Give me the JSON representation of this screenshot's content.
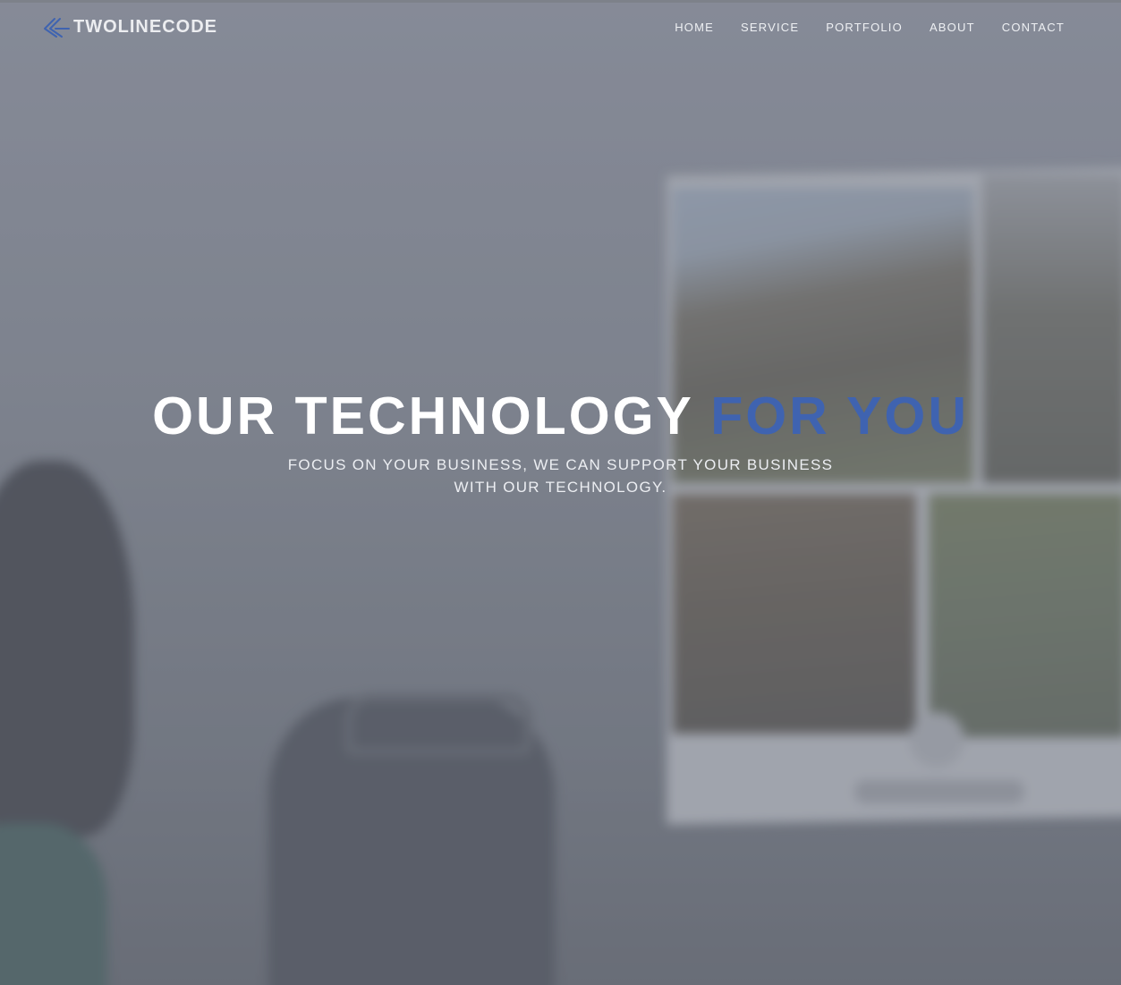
{
  "brand": {
    "name": "TWOLINECODE",
    "icon": "double-chevron-logo-icon",
    "accent_color": "#3f63b0"
  },
  "nav": {
    "items": [
      {
        "label": "HOME"
      },
      {
        "label": "SERVICE"
      },
      {
        "label": "PORTFOLIO"
      },
      {
        "label": "ABOUT"
      },
      {
        "label": "CONTACT"
      }
    ]
  },
  "hero": {
    "headline_main": "OUR TECHNOLOGY",
    "headline_accent": "FOR YOU",
    "tagline_line1": "FOCUS ON YOUR BUSINESS, WE CAN SUPPORT YOUR BUSINESS",
    "tagline_line2": "WITH OUR TECHNOLOGY.",
    "headline_color": "#ffffff",
    "accent_color": "#3f63b0"
  }
}
